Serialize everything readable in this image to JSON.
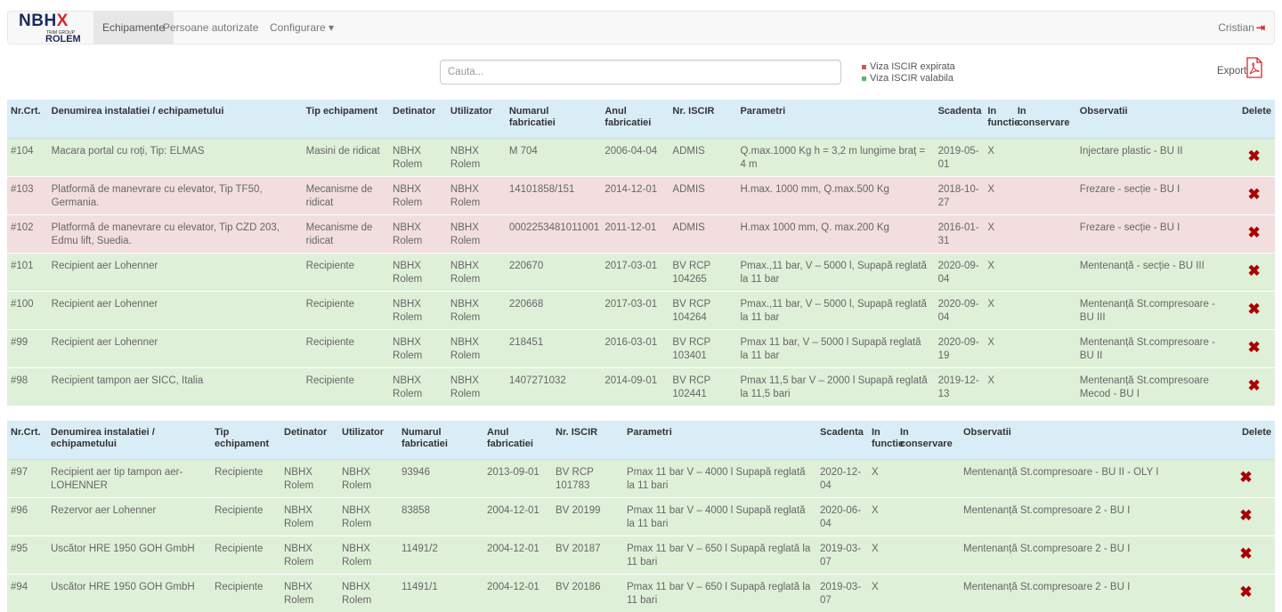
{
  "nav": {
    "logo_top": "NBH",
    "logo_x": "X",
    "logo_mid": "TRIM GROUP",
    "logo_bottom": "ROLEM",
    "items": [
      "Echipamente",
      "Persoane autorizate",
      "Configurare ▾"
    ],
    "user": "Cristian"
  },
  "toolbar": {
    "search_placeholder": "Cauta...",
    "legend_expired": "Viza ISCIR expirata",
    "legend_valid": "Viza ISCIR valabila",
    "legend_expired_color": "#d9534f",
    "legend_valid_color": "#5cb85c",
    "export_label": "Export"
  },
  "colors": {
    "header_bg": "#d9edf7",
    "row_valid": "#dff0d8",
    "row_expired": "#f2dede",
    "delete": "#aa0000"
  },
  "table1": {
    "headers": [
      "Nr.Crt.",
      "Denumirea instalatiei / echipametului",
      "Tip echipament",
      "Detinator",
      "Utilizator",
      "Numarul fabricatiei",
      "Anul fabricatiei",
      "Nr. ISCIR",
      "Parametri",
      "Scadenta",
      "In functie",
      "In conservare",
      "Observatii",
      "Delete"
    ],
    "rows": [
      {
        "status": "ok",
        "c": [
          "#104",
          "Macara portal cu roți, Tip: ELMAS",
          "Masini de ridicat",
          "NBHX Rolem",
          "NBHX Rolem",
          "M 704",
          "2006-04-04",
          "ADMIS",
          "Q.max.1000 Kg h = 3,2 m lungime braț = 4 m",
          "2019-05-01",
          "X",
          "",
          "Injectare plastic - BU II"
        ]
      },
      {
        "status": "exp",
        "c": [
          "#103",
          "Platformă de manevrare cu elevator, Tip TF50, Germania.",
          "Mecanisme de ridicat",
          "NBHX Rolem",
          "NBHX Rolem",
          "14101858/151",
          "2014-12-01",
          "ADMIS",
          "H.max. 1000 mm, Q.max.500 Kg",
          "2018-10-27",
          "X",
          "",
          "Frezare - secție - BU I"
        ]
      },
      {
        "status": "exp",
        "c": [
          "#102",
          "Platformă de manevrare cu elevator, Tip CZD 203, Edmu lift, Suedia.",
          "Mecanisme de ridicat",
          "NBHX Rolem",
          "NBHX Rolem",
          "0002253481011001",
          "2011-12-01",
          "ADMIS",
          "H.max 1000 mm, Q. max.200 Kg",
          "2016-01-31",
          "X",
          "",
          "Frezare - secție - BU I"
        ]
      },
      {
        "status": "ok",
        "c": [
          "#101",
          "Recipient aer Lohenner",
          "Recipiente",
          "NBHX Rolem",
          "NBHX Rolem",
          "220670",
          "2017-03-01",
          "BV RCP 104265",
          "Pmax.,11 bar, V – 5000 l, Supapă reglată la 11 bar",
          "2020-09-04",
          "X",
          "",
          "Mentenanță - secție - BU III"
        ]
      },
      {
        "status": "ok",
        "c": [
          "#100",
          "Recipient aer Lohenner",
          "Recipiente",
          "NBHX Rolem",
          "NBHX Rolem",
          "220668",
          "2017-03-01",
          "BV RCP 104264",
          "Pmax.,11 bar, V – 5000 l, Supapă reglată la 11 bar",
          "2020-09-04",
          "X",
          "",
          "Mentenanță St.compresoare - BU III"
        ]
      },
      {
        "status": "ok",
        "c": [
          "#99",
          "Recipient aer Lohenner",
          "Recipiente",
          "NBHX Rolem",
          "NBHX Rolem",
          "218451",
          "2016-03-01",
          "BV RCP 103401",
          "Pmax 11 bar, V – 5000 l Supapă reglată la 11 bar",
          "2020-09-19",
          "X",
          "",
          "Mentenanță St.compresoare - BU II"
        ]
      },
      {
        "status": "ok",
        "c": [
          "#98",
          "Recipient tampon aer SICC, Italia",
          "Recipiente",
          "NBHX Rolem",
          "NBHX Rolem",
          "1407271032",
          "2014-09-01",
          "BV RCP 102441",
          "Pmax 11,5 bar V – 2000 l Supapă reglată la 11,5 bari",
          "2019-12-13",
          "X",
          "",
          "Mentenanță St.compresoare Mecod - BU I"
        ]
      }
    ]
  },
  "table2": {
    "headers": [
      "Nr.Crt.",
      "Denumirea instalatiei / echipametului",
      "Tip echipament",
      "Detinator",
      "Utilizator",
      "Numarul fabricatiei",
      "Anul fabricatiei",
      "Nr. ISCIR",
      "Parametri",
      "Scadenta",
      "In functie",
      "In conservare",
      "Observatii",
      "Delete"
    ],
    "rows": [
      {
        "status": "ok",
        "c": [
          "#97",
          "Recipient aer tip tampon aer-LOHENNER",
          "Recipiente",
          "NBHX Rolem",
          "NBHX Rolem",
          "93946",
          "2013-09-01",
          "BV RCP 101783",
          "Pmax 11 bar V – 4000 l Supapă reglată la 11 bari",
          "2020-12-04",
          "X",
          "",
          "Mentenanță St.compresoare - BU II - OLY I"
        ]
      },
      {
        "status": "ok",
        "c": [
          "#96",
          "Rezervor aer Lohenner",
          "Recipiente",
          "NBHX Rolem",
          "NBHX Rolem",
          "83858",
          "2004-12-01",
          "BV 20199",
          "Pmax 11 bar V – 4000 l Supapă reglată la 11 bari",
          "2020-06-04",
          "X",
          "",
          "Mentenanță St.compresoare 2 - BU I"
        ]
      },
      {
        "status": "ok",
        "c": [
          "#95",
          "Uscător HRE 1950 GOH GmbH",
          "Recipiente",
          "NBHX Rolem",
          "NBHX Rolem",
          "11491/2",
          "2004-12-01",
          "BV 20187",
          "Pmax 11 bar V – 650 l Supapă reglată la 11 bari",
          "2019-03-07",
          "X",
          "",
          "Mentenanță St.compresoare 2 - BU I"
        ]
      },
      {
        "status": "ok",
        "c": [
          "#94",
          "Uscător HRE 1950 GOH GmbH",
          "Recipiente",
          "NBHX Rolem",
          "NBHX Rolem",
          "11491/1",
          "2004-12-01",
          "BV 20186",
          "Pmax 11 bar V – 650 l Supapă reglată la 11 bari",
          "2019-03-07",
          "X",
          "",
          "Mentenanță St.compresoare 2 - BU I"
        ]
      }
    ]
  }
}
